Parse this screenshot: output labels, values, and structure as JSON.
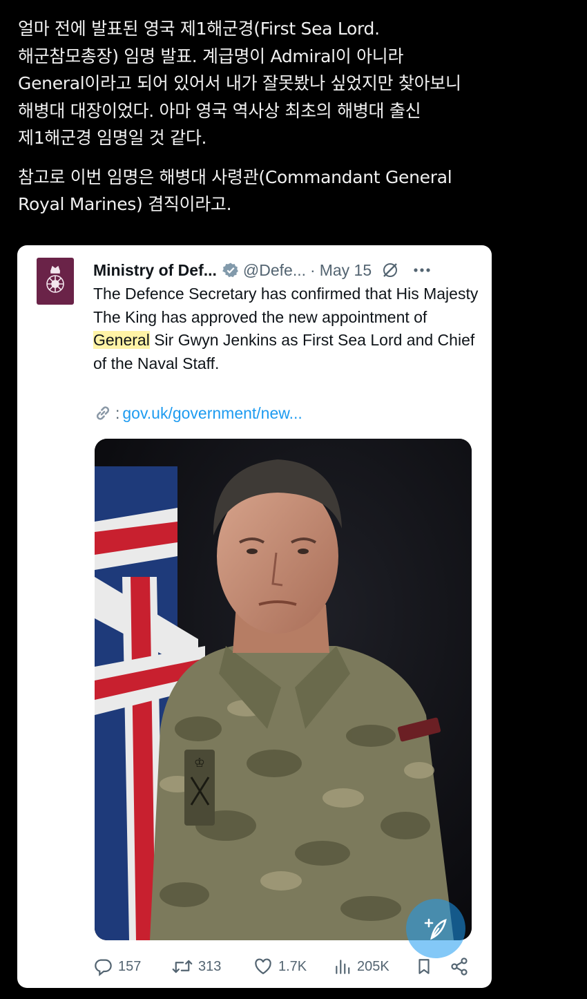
{
  "post": {
    "paragraph1": "얼마 전에 발표된 영국 제1해군경(First Sea Lord.\n해군참모총장) 임명 발표. 계급명이 Admiral이 아니라\nGeneral이라고 되어 있어서 내가 잘못봤나 싶었지만 찾아보니\n해병대 대장이었다. 아마 영국 역사상 최초의 해병대 출신\n제1해군경 임명일 것 같다.",
    "paragraph2": "참고로 이번 임명은 해병대 사령관(Commandant General\nRoyal Marines) 겸직이라고."
  },
  "tweet": {
    "author_name": "Ministry of Def...",
    "handle": "@Defe...",
    "dot": "·",
    "date": "May 15",
    "text_before": "The Defence Secretary has confirmed that His Majesty The King has approved the new appointment of ",
    "text_highlight": "General",
    "text_after": " Sir Gwyn Jenkins as First Sea Lord and Chief of the Naval Staff.",
    "link_colon": ":",
    "link": "gov.uk/government/new...",
    "stats": {
      "replies": "157",
      "retweets": "313",
      "likes": "1.7K",
      "views": "205K"
    }
  },
  "colors": {
    "background": "#000000",
    "card": "#ffffff",
    "avatar": "#6a2348",
    "link": "#1d9bf0",
    "highlight": "#fff3a6",
    "verified": "#829aab"
  },
  "icons": [
    "mod-crest-icon",
    "verified-icon",
    "grok-icon",
    "more-icon",
    "link-icon",
    "reply-icon",
    "retweet-icon",
    "like-icon",
    "views-icon",
    "bookmark-icon",
    "share-icon",
    "compose-icon"
  ]
}
